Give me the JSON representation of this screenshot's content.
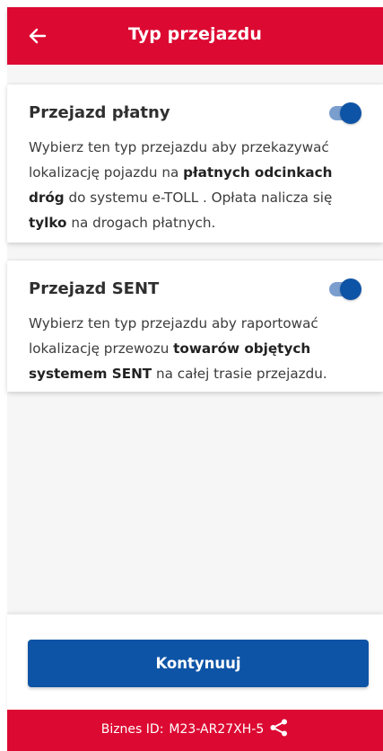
{
  "header": {
    "title": "Typ przejazdu"
  },
  "cards": [
    {
      "title": "Przejazd płatny",
      "enabled": true,
      "description": [
        {
          "text": "Wybierz ten typ przejazdu aby przekazywać lokalizację pojazdu na ",
          "bold": false
        },
        {
          "text": "płatnych odcinkach dróg",
          "bold": true
        },
        {
          "text": " do systemu e-TOLL . Opłata nalicza się ",
          "bold": false
        },
        {
          "text": "tylko",
          "bold": true
        },
        {
          "text": " na drogach płatnych.",
          "bold": false
        }
      ]
    },
    {
      "title": "Przejazd SENT",
      "enabled": true,
      "description": [
        {
          "text": "Wybierz ten typ przejazdu aby raportować lokalizację przewozu ",
          "bold": false
        },
        {
          "text": "towarów objętych systemem SENT",
          "bold": true
        },
        {
          "text": " na całej trasie przejazdu.",
          "bold": false
        }
      ]
    }
  ],
  "continue_label": "Kontynuuj",
  "footer": {
    "id_label": "Biznes ID:",
    "id_value": "M23-AR27XH-5"
  },
  "colors": {
    "brand_red": "#dc0a32",
    "primary_blue": "#0e54a6",
    "toggle_track": "#7a9fcf"
  },
  "icons": {
    "back": "arrow-left-icon",
    "share": "share-icon"
  }
}
